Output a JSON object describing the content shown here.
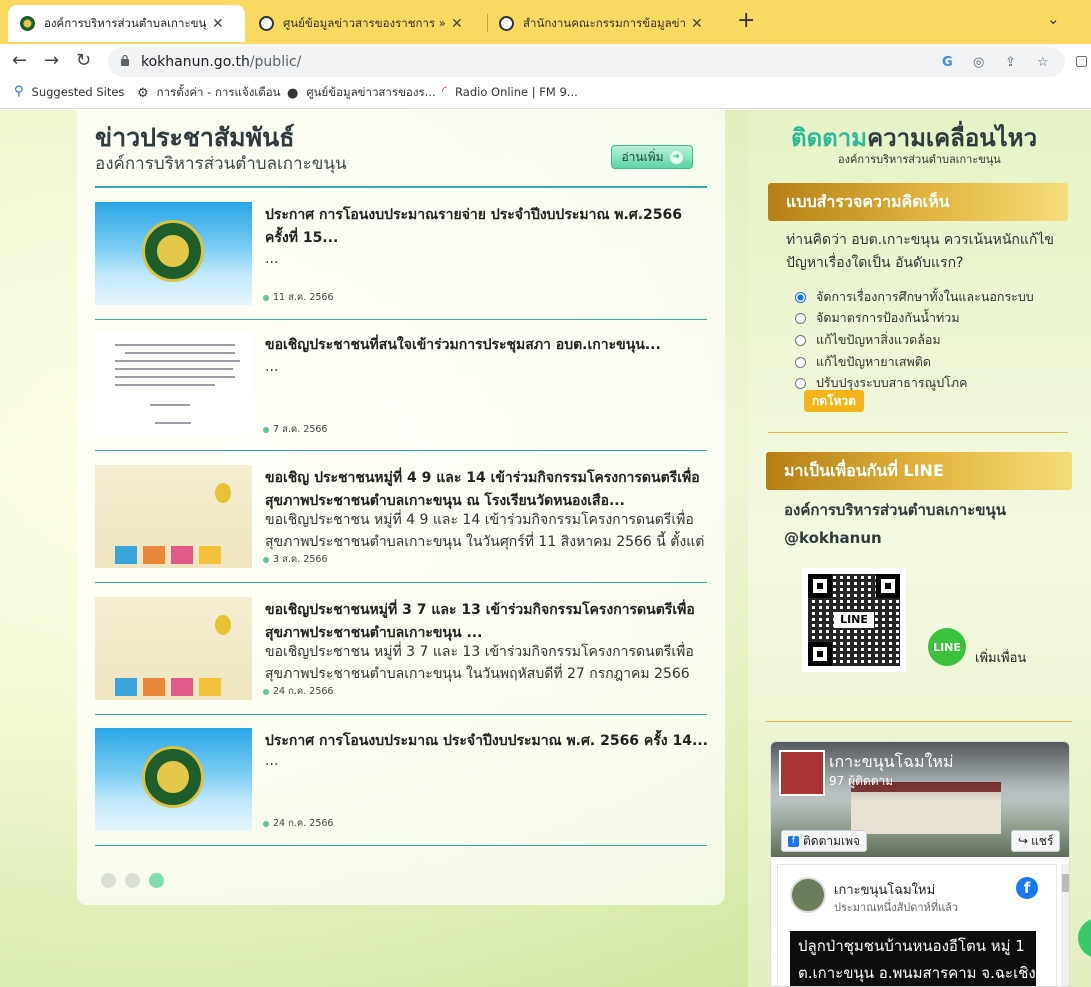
{
  "browser": {
    "tabs": [
      {
        "title": "องค์การบริหารส่วนตำบลเกาะขนุน ( อบ",
        "active": true
      },
      {
        "title": "ศูนย์ข้อมูลข่าวสารของราชการ » องค์ก",
        "active": false
      },
      {
        "title": "สำนักงานคณะกรรมการข้อมูลข่าวสารข",
        "active": false
      }
    ],
    "url_host": "kokhanun.go.th",
    "url_path": "/public/",
    "bookmarks": [
      {
        "label": "Suggested Sites",
        "icon": "search-icon"
      },
      {
        "label": "การตั้งค่า - การแจ้งเตือน",
        "icon": "gear-icon"
      },
      {
        "label": "ศูนย์ข้อมูลข่าวสารของร...",
        "icon": "globe-icon"
      },
      {
        "label": "Radio Online | FM 9...",
        "icon": "radio-icon"
      }
    ]
  },
  "news": {
    "title": "ข่าวประชาสัมพันธ์",
    "subtitle": "องค์การบริหารส่วนตำบลเกาะขนุน",
    "read_more": "อ่านเพิ่ม",
    "items": [
      {
        "title": "ประกาศ การโอนงบประมาณรายจ่าย ประจำปีงบประมาณ พ.ศ.2566 ครั้งที่ 15...",
        "desc": "...",
        "date": "11 ส.ค. 2566"
      },
      {
        "title": "ขอเชิญประชาชนที่สนใจเข้าร่วมการประชุมสภา อบต.เกาะขนุน...",
        "desc": "...",
        "date": "7 ส.ค. 2566"
      },
      {
        "title": "ขอเชิญ ประชาชนหมู่ที่ 4 9 และ 14 เข้าร่วมกิจกรรมโครงการดนตรีเพื่อสุขภาพประชาชนตำบลเกาะขนุน ณ โรงเรียนวัดหนองเสือ...",
        "desc": "ขอเชิญประชาชน หมู่ที่ 4 9  และ 14 เข้าร่วมกิจกรรมโครงการดนตรีเพื่อสุขภาพประชาชนตำบลเกาะขนุน ในวันศุกร์ที่   11 สิงหาคม   2566 นี้ ตั้งแต่",
        "date": "3 ส.ค. 2566"
      },
      {
        "title": "ขอเชิญประชาชนหมู่ที่ 3 7 และ 13 เข้าร่วมกิจกรรมโครงการดนตรีเพื่อสุขภาพประชาชนตำบลเกาะขนุน ...",
        "desc": "ขอเชิญประชาชน หมู่ที่ 3 7 และ 13 เข้าร่วมกิจกรรมโครงการดนตรีเพื่อสุขภาพประชาชนตำบลเกาะขนุน ในวันพฤหัสบดีที่ 27 กรกฎาคม 2566 นี้...",
        "date": "24 ก.ค. 2566"
      },
      {
        "title": "ประกาศ การโอนงบประมาณ ประจำปีงบประมาณ พ.ศ. 2566 ครั้ง 14...",
        "desc": "...",
        "date": "24 ก.ค. 2566"
      }
    ]
  },
  "sidebar": {
    "follow_highlight": "ติดตาม",
    "follow_rest": "ความเคลื่อนไหว",
    "follow_sub": "องค์การบริหารส่วนตำบลเกาะขนุน",
    "poll_header": "แบบสำรวจความคิดเห็น",
    "poll_question": "ท่านคิดว่า อบต.เกาะขนุน ควรเน้นหนักแก้ไขปัญหาเรื่องใดเป็น อันดับแรก?",
    "poll_options": [
      {
        "label": "จัดการเรื่องการศึกษาทั้งในและนอกระบบ",
        "selected": true
      },
      {
        "label": "จัดมาตรการป้องกันน้ำท่วม",
        "selected": false
      },
      {
        "label": "แก้ไขปัญหาสิ่งแวดล้อม",
        "selected": false
      },
      {
        "label": "แก้ไขปัญหายาเสพติด",
        "selected": false
      },
      {
        "label": "ปรับปรุงระบบสาธารณูปโภค",
        "selected": false
      }
    ],
    "vote_button": "กดโหวต",
    "line_header": "มาเป็นเพื่อนกันที่ LINE",
    "line_org": "องค์การบริหารส่วนตำบลเกาะขนุน",
    "line_id": "@kokhanun",
    "qr_label": "LINE",
    "line_badge": "LINE",
    "add_friend": "เพิ่มเพื่อน",
    "facebook": {
      "page_name": "เกาะขนุนโฉมใหม่",
      "followers": "97 ผู้ติดตาม",
      "follow_button": "ติดตามเพจ",
      "share_button": "แชร์",
      "post_author": "เกาะขนุนโฉมใหม่",
      "post_time": "ประมาณหนึ่งสัปดาห์ที่แล้ว",
      "post_line1": "ปลูกป่าชุมชนบ้านหนองอีโตน หมู่ 1",
      "post_line2": "ต.เกาะขนุน อ.พนมสารคาม จ.ฉะเชิงเทรา"
    }
  },
  "colors": {
    "tabbar": "#fad960",
    "accent_teal": "#2fb99b",
    "gold": "#e3b641"
  }
}
